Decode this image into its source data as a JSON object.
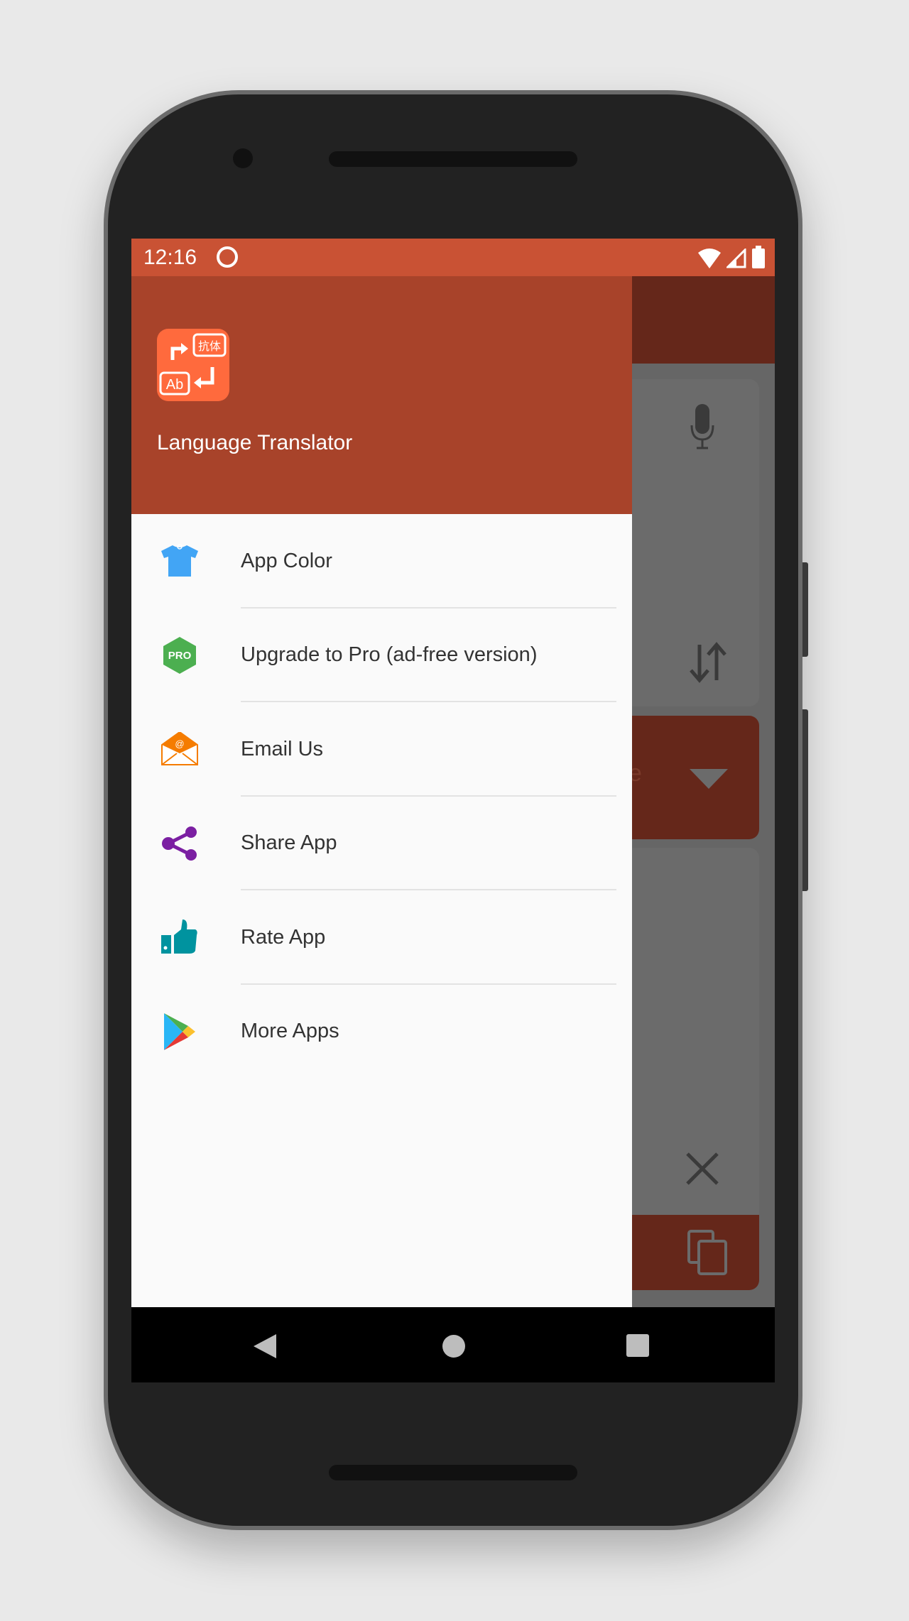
{
  "status_bar": {
    "time": "12:16",
    "icons": [
      "data-saver-icon",
      "wifi-icon",
      "signal-icon",
      "battery-icon"
    ],
    "color": "#c95234"
  },
  "drawer": {
    "header": {
      "app_name": "Language Translator",
      "logo_text_cn": "抗体",
      "logo_text_en": "Ab",
      "color": "#a8432a"
    },
    "items": [
      {
        "label": "App Color",
        "icon": "tshirt-icon",
        "color": "#42a5f5"
      },
      {
        "label": "Upgrade to Pro (ad-free version)",
        "icon": "pro-badge-icon",
        "badge": "PRO",
        "color": "#4caf50"
      },
      {
        "label": "Email Us",
        "icon": "email-icon",
        "color": "#f57c00"
      },
      {
        "label": "Share App",
        "icon": "share-icon",
        "color": "#7b1fa2"
      },
      {
        "label": "Rate App",
        "icon": "thumbs-up-icon",
        "color": "#00939f"
      },
      {
        "label": "More Apps",
        "icon": "play-store-icon"
      }
    ]
  },
  "background_app": {
    "partial_text": "e"
  },
  "nav_bar": {
    "buttons": [
      "back",
      "home",
      "recents"
    ]
  }
}
